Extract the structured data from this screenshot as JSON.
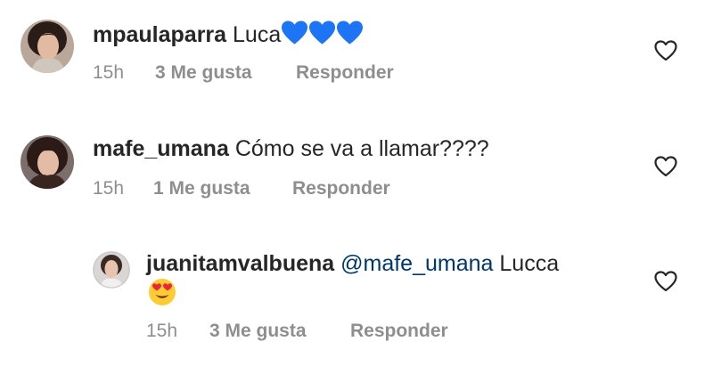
{
  "comments": [
    {
      "username": "mpaulaparra",
      "text": "Luca",
      "emoji": [
        "blue-heart",
        "blue-heart",
        "blue-heart"
      ],
      "time": "15h",
      "likes": "3 Me gusta",
      "reply": "Responder"
    },
    {
      "username": "mafe_umana",
      "text": "Cómo se va a llamar????",
      "time": "15h",
      "likes": "1 Me gusta",
      "reply": "Responder"
    }
  ],
  "reply": {
    "username": "juanitamvalbuena",
    "mention": "@mafe_umana",
    "text": "Lucca",
    "emoji": "heart-eyes-face",
    "time": "15h",
    "likes": "3 Me gusta",
    "reply": "Responder"
  },
  "colors": {
    "text": "#262626",
    "meta": "#8e8e8e",
    "mention": "#00376b",
    "blue_heart": "#1d74f5"
  }
}
